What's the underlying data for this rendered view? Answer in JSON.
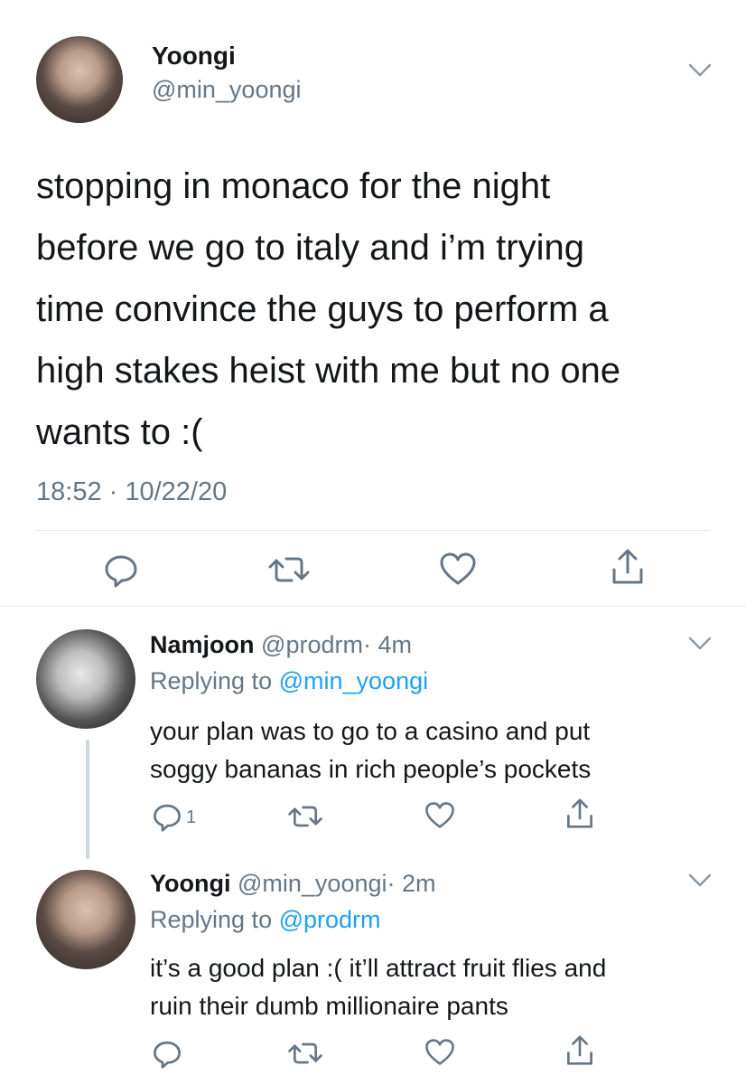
{
  "main_tweet": {
    "name": "Yoongi",
    "handle": "@min_yoongi",
    "text_lines": [
      "stopping in monaco for the night",
      "before we go to italy and i’m trying",
      "time convince the guys to perform a",
      "high stakes heist with me but no one",
      "wants to :("
    ],
    "timestamp": "18:52 · 10/22/20"
  },
  "replies": [
    {
      "name": "Namjoon",
      "handle": "@prodrm",
      "time": "· 4m",
      "replying_label": "Replying to",
      "replying_handle": "@min_yoongi",
      "text_lines": [
        "your plan was to go to a casino and put",
        "soggy bananas in rich people’s pockets"
      ],
      "reply_count": "1"
    },
    {
      "name": "Yoongi",
      "handle": "@min_yoongi",
      "time": "· 2m",
      "replying_label": "Replying to",
      "replying_handle": "@prodrm",
      "text_lines": [
        "it’s a good plan :( it’ll attract fruit flies and",
        "ruin their dumb millionaire pants"
      ],
      "reply_count": ""
    }
  ],
  "icons": {
    "reply": "reply-icon",
    "retweet": "retweet-icon",
    "like": "heart-icon",
    "share": "share-icon",
    "menu": "chevron-down-icon"
  },
  "colors": {
    "text": "#14171a",
    "secondary": "#657786",
    "link": "#1da1f2",
    "divider": "#e1e8ed"
  }
}
